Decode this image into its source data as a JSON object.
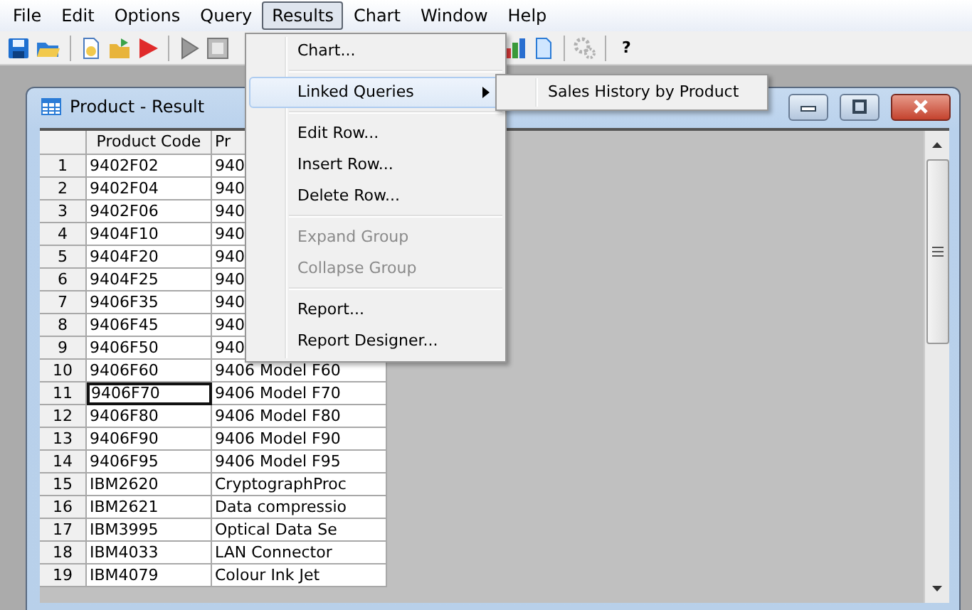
{
  "menubar": [
    {
      "label": "File",
      "selected": false
    },
    {
      "label": "Edit",
      "selected": false
    },
    {
      "label": "Options",
      "selected": false
    },
    {
      "label": "Query",
      "selected": false
    },
    {
      "label": "Results",
      "selected": true
    },
    {
      "label": "Chart",
      "selected": false
    },
    {
      "label": "Window",
      "selected": false
    },
    {
      "label": "Help",
      "selected": false
    }
  ],
  "toolbar": {
    "help_label": "?",
    "settings_disabled": true
  },
  "results_menu": [
    {
      "kind": "item",
      "label": "Chart...",
      "disabled": false,
      "selected": false,
      "submenu": false
    },
    {
      "kind": "separator"
    },
    {
      "kind": "item",
      "label": "Linked Queries",
      "disabled": false,
      "selected": true,
      "submenu": true
    },
    {
      "kind": "separator"
    },
    {
      "kind": "item",
      "label": "Edit Row...",
      "disabled": false,
      "selected": false,
      "submenu": false
    },
    {
      "kind": "item",
      "label": "Insert Row...",
      "disabled": false,
      "selected": false,
      "submenu": false
    },
    {
      "kind": "item",
      "label": "Delete Row...",
      "disabled": false,
      "selected": false,
      "submenu": false
    },
    {
      "kind": "separator"
    },
    {
      "kind": "item",
      "label": "Expand Group",
      "disabled": true,
      "selected": false,
      "submenu": false
    },
    {
      "kind": "item",
      "label": "Collapse Group",
      "disabled": true,
      "selected": false,
      "submenu": false
    },
    {
      "kind": "separator"
    },
    {
      "kind": "item",
      "label": "Report...",
      "disabled": false,
      "selected": false,
      "submenu": false
    },
    {
      "kind": "item",
      "label": "Report Designer...",
      "disabled": false,
      "selected": false,
      "submenu": false
    }
  ],
  "linked_queries_submenu": [
    "Sales History by Product"
  ],
  "window": {
    "title": "Product - Result"
  },
  "table": {
    "columns": [
      "",
      "Product Code",
      "Pr"
    ],
    "rows": [
      {
        "num": "1",
        "code": "9402F02",
        "name": "940",
        "selected": false
      },
      {
        "num": "2",
        "code": "9402F04",
        "name": "940",
        "selected": false
      },
      {
        "num": "3",
        "code": "9402F06",
        "name": "940",
        "selected": false
      },
      {
        "num": "4",
        "code": "9404F10",
        "name": "940",
        "selected": false
      },
      {
        "num": "5",
        "code": "9404F20",
        "name": "940",
        "selected": false
      },
      {
        "num": "6",
        "code": "9404F25",
        "name": "940",
        "selected": false
      },
      {
        "num": "7",
        "code": "9406F35",
        "name": "940",
        "selected": false
      },
      {
        "num": "8",
        "code": "9406F45",
        "name": "940",
        "selected": false
      },
      {
        "num": "9",
        "code": "9406F50",
        "name": "940",
        "selected": false
      },
      {
        "num": "10",
        "code": "9406F60",
        "name": "9406 Model F60",
        "selected": false
      },
      {
        "num": "11",
        "code": "9406F70",
        "name": "9406 Model F70",
        "selected": true
      },
      {
        "num": "12",
        "code": "9406F80",
        "name": "9406 Model F80",
        "selected": false
      },
      {
        "num": "13",
        "code": "9406F90",
        "name": "9406 Model F90",
        "selected": false
      },
      {
        "num": "14",
        "code": "9406F95",
        "name": "9406 Model F95",
        "selected": false
      },
      {
        "num": "15",
        "code": "IBM2620",
        "name": "CryptographProc",
        "selected": false
      },
      {
        "num": "16",
        "code": "IBM2621",
        "name": "Data compressio",
        "selected": false
      },
      {
        "num": "17",
        "code": "IBM3995",
        "name": "Optical Data Se",
        "selected": false
      },
      {
        "num": "18",
        "code": "IBM4033",
        "name": "LAN Connector",
        "selected": false
      },
      {
        "num": "19",
        "code": "IBM4079",
        "name": "Colour Ink Jet",
        "selected": false
      }
    ]
  }
}
